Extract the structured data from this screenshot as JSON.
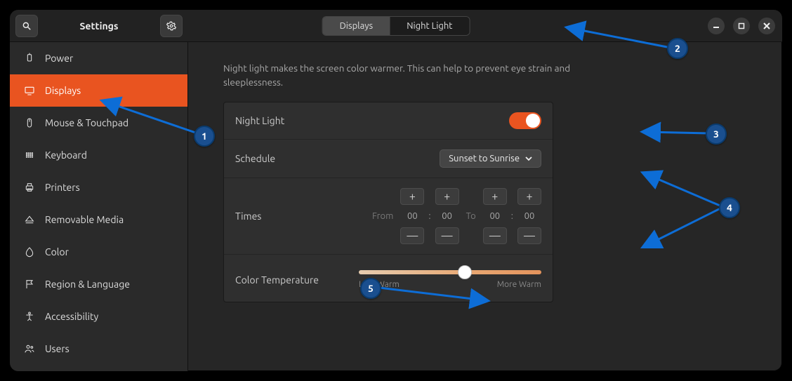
{
  "header": {
    "title": "Settings",
    "search_icon": "search",
    "menu_icon": "gear"
  },
  "tabs": {
    "left": {
      "label": "Displays",
      "active": false
    },
    "right": {
      "label": "Night Light",
      "active": true
    }
  },
  "window_controls": {
    "minimize": "–",
    "maximize": "⛶",
    "close": "✕"
  },
  "sidebar": {
    "items": [
      {
        "label": "Power",
        "icon": "power"
      },
      {
        "label": "Displays",
        "icon": "display",
        "active": true
      },
      {
        "label": "Mouse & Touchpad",
        "icon": "mouse"
      },
      {
        "label": "Keyboard",
        "icon": "keyboard"
      },
      {
        "label": "Printers",
        "icon": "printer"
      },
      {
        "label": "Removable Media",
        "icon": "eject"
      },
      {
        "label": "Color",
        "icon": "color"
      },
      {
        "label": "Region & Language",
        "icon": "flag"
      },
      {
        "label": "Accessibility",
        "icon": "accessibility"
      },
      {
        "label": "Users",
        "icon": "users"
      }
    ]
  },
  "main": {
    "description": "Night light makes the screen color warmer. This can help to prevent eye strain and sleeplessness.",
    "night_light": {
      "label": "Night Light",
      "enabled": true
    },
    "schedule": {
      "label": "Schedule",
      "selected": "Sunset to Sunrise"
    },
    "times": {
      "label": "Times",
      "from_label": "From",
      "to_label": "To",
      "from": {
        "h": "00",
        "m": "00"
      },
      "to": {
        "h": "00",
        "m": "00"
      }
    },
    "color_temp": {
      "label": "Color Temperature",
      "less": "Less Warm",
      "more": "More Warm",
      "value_percent": 58
    }
  },
  "annotations": {
    "1": "Displays sidebar entry",
    "2": "Night Light tab",
    "3": "Night Light toggle",
    "4": "Schedule / Times controls",
    "5": "Color Temperature slider"
  },
  "colors": {
    "accent": "#e95420",
    "arrow": "#0d6dd6",
    "callout": "#1a4f8f"
  }
}
